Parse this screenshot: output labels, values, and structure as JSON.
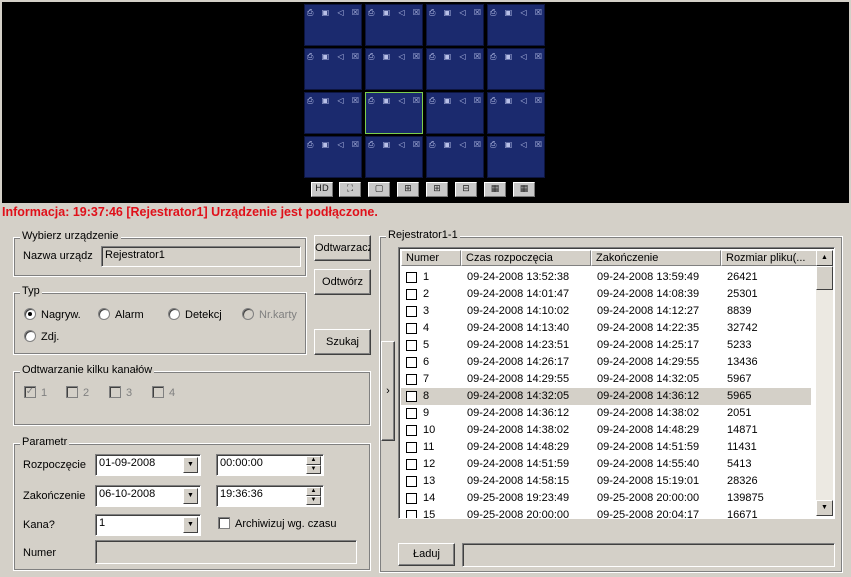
{
  "video": {
    "cell_icons": [
      "cam-icon",
      "rec-icon",
      "speaker-icon",
      "close-icon"
    ],
    "toolbar": [
      "HD",
      "fullscreen",
      "1-split",
      "4-split",
      "6-split",
      "8-split",
      "9-split",
      "16-split"
    ],
    "toolbar_glyphs": [
      "HD",
      "⛶",
      "▢",
      "⊞",
      "⊞",
      "⊟",
      "▦",
      "▦"
    ]
  },
  "info": "Informacja:  19:37:46  [Rejestrator1] Urządzenie jest podłączone.",
  "device": {
    "legend": "Wybierz urządzenie",
    "label": "Nazwa urządz",
    "value": "Rejestrator1"
  },
  "type": {
    "legend": "Typ",
    "options": [
      "Nagryw.",
      "Alarm",
      "Detekcj",
      "Nr.karty",
      "Zdj."
    ],
    "selected": "Nagryw."
  },
  "multi": {
    "legend": "Odtwarzanie kilku kanałów",
    "channels": [
      "1",
      "2",
      "3",
      "4"
    ]
  },
  "buttons": {
    "playback": "Odtwarzacz",
    "play": "Odtwórz",
    "search": "Szukaj",
    "load": "Ładuj",
    "toggle": "›"
  },
  "params": {
    "legend": "Parametr",
    "start_label": "Rozpoczęcie",
    "start_date": "01-09-2008",
    "start_time": "00:00:00",
    "end_label": "Zakończenie",
    "end_date": "06-10-2008",
    "end_time": "19:36:36",
    "channel_label": "Kana?",
    "channel_value": "1",
    "archive_label": "Archiwizuj wg. czasu",
    "number_label": "Numer",
    "number_value": ""
  },
  "recorder": {
    "legend": "Rejestrator1-1",
    "columns": [
      "Numer",
      "Czas rozpoczęcia",
      "Zakończenie",
      "Rozmiar pliku(..."
    ],
    "selected_row": "8",
    "rows": [
      [
        "1",
        "09-24-2008 13:52:38",
        "09-24-2008 13:59:49",
        "26421"
      ],
      [
        "2",
        "09-24-2008 14:01:47",
        "09-24-2008 14:08:39",
        "25301"
      ],
      [
        "3",
        "09-24-2008 14:10:02",
        "09-24-2008 14:12:27",
        "8839"
      ],
      [
        "4",
        "09-24-2008 14:13:40",
        "09-24-2008 14:22:35",
        "32742"
      ],
      [
        "5",
        "09-24-2008 14:23:51",
        "09-24-2008 14:25:17",
        "5233"
      ],
      [
        "6",
        "09-24-2008 14:26:17",
        "09-24-2008 14:29:55",
        "13436"
      ],
      [
        "7",
        "09-24-2008 14:29:55",
        "09-24-2008 14:32:05",
        "5967"
      ],
      [
        "8",
        "09-24-2008 14:32:05",
        "09-24-2008 14:36:12",
        "5965"
      ],
      [
        "9",
        "09-24-2008 14:36:12",
        "09-24-2008 14:38:02",
        "2051"
      ],
      [
        "10",
        "09-24-2008 14:38:02",
        "09-24-2008 14:48:29",
        "14871"
      ],
      [
        "11",
        "09-24-2008 14:48:29",
        "09-24-2008 14:51:59",
        "11431"
      ],
      [
        "12",
        "09-24-2008 14:51:59",
        "09-24-2008 14:55:40",
        "5413"
      ],
      [
        "13",
        "09-24-2008 14:58:15",
        "09-24-2008 15:19:01",
        "28326"
      ],
      [
        "14",
        "09-25-2008 19:23:49",
        "09-25-2008 20:00:00",
        "139875"
      ],
      [
        "15",
        "09-25-2008 20:00:00",
        "09-25-2008 20:04:17",
        "16671"
      ]
    ]
  },
  "load_status": ""
}
